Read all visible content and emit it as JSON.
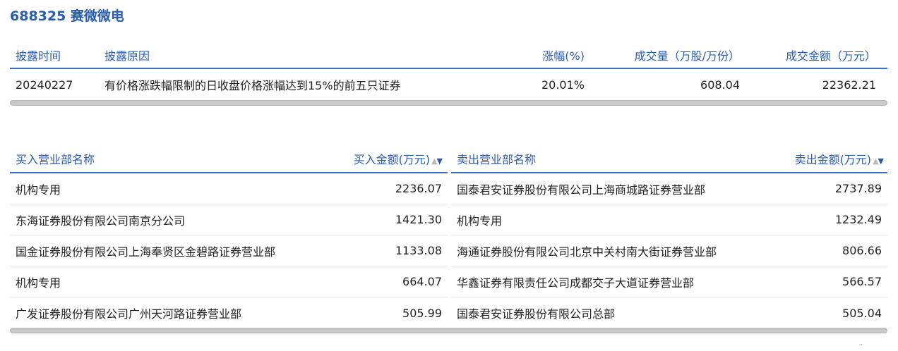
{
  "title": "688325 赛微微电",
  "disclosure": {
    "headers": {
      "time": "披露时间",
      "reason": "披露原因",
      "change": "涨幅(%)",
      "volume": "成交量（万股/万份）",
      "amount": "成交金额（万元）"
    },
    "row": {
      "time": "20240227",
      "reason": "有价格涨跌幅限制的日收盘价格涨幅达到15%的前五只证券",
      "change": "20.01%",
      "volume": "608.04",
      "amount": "22362.21"
    }
  },
  "buy": {
    "headers": {
      "name": "买入营业部名称",
      "amount": "买入金额(万元)"
    },
    "rows": [
      {
        "name": "机构专用",
        "amount": "2236.07"
      },
      {
        "name": "东海证券股份有限公司南京分公司",
        "amount": "1421.30"
      },
      {
        "name": "国金证券股份有限公司上海奉贤区金碧路证券营业部",
        "amount": "1133.08"
      },
      {
        "name": "机构专用",
        "amount": "664.07"
      },
      {
        "name": "广发证券股份有限公司广州天河路证券营业部",
        "amount": "505.99"
      }
    ]
  },
  "sell": {
    "headers": {
      "name": "卖出营业部名称",
      "amount": "卖出金额(万元)"
    },
    "rows": [
      {
        "name": "国泰君安证券股份有限公司上海商城路证券营业部",
        "amount": "2737.89"
      },
      {
        "name": "机构专用",
        "amount": "1232.49"
      },
      {
        "name": "海通证券股份有限公司北京中关村南大街证券营业部",
        "amount": "806.66"
      },
      {
        "name": "华鑫证券有限责任公司成都交子大道证券营业部",
        "amount": "566.57"
      },
      {
        "name": "国泰君安证券股份有限公司总部",
        "amount": "505.04"
      }
    ]
  },
  "colors": {
    "accent": "#2a5cad",
    "header_line": "#3b6fc6",
    "scrollbar": "#c9c9c9"
  }
}
